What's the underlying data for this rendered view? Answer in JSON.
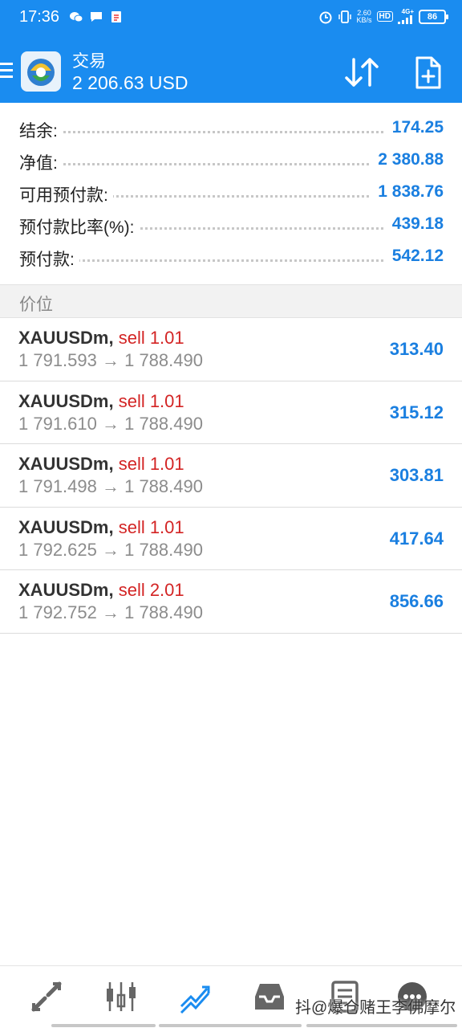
{
  "status_bar": {
    "time": "17:36",
    "net_speed_value": "2.60",
    "net_speed_unit": "KB/s",
    "hd_label": "HD",
    "network_label": "4G+",
    "battery": "86"
  },
  "app_bar": {
    "title": "交易",
    "balance": "2 206.63 USD"
  },
  "summary": [
    {
      "label": "结余:",
      "value": "174.25"
    },
    {
      "label": "净值:",
      "value": "2 380.88"
    },
    {
      "label": "可用预付款:",
      "value": "1 838.76"
    },
    {
      "label": "预付款比率(%):",
      "value": "439.18"
    },
    {
      "label": "预付款:",
      "value": "542.12"
    }
  ],
  "section_header": "价位",
  "positions": [
    {
      "symbol": "XAUUSDm,",
      "side": "sell 1.01",
      "prices": "1 791.593 → 1 788.490",
      "profit": "313.40"
    },
    {
      "symbol": "XAUUSDm,",
      "side": "sell 1.01",
      "prices": "1 791.610 → 1 788.490",
      "profit": "315.12"
    },
    {
      "symbol": "XAUUSDm,",
      "side": "sell 1.01",
      "prices": "1 791.498 → 1 788.490",
      "profit": "303.81"
    },
    {
      "symbol": "XAUUSDm,",
      "side": "sell 1.01",
      "prices": "1 792.625 → 1 788.490",
      "profit": "417.64"
    },
    {
      "symbol": "XAUUSDm,",
      "side": "sell 2.01",
      "prices": "1 792.752 → 1 788.490",
      "profit": "856.66"
    }
  ],
  "bottom_nav": {
    "items": [
      "quotes-icon",
      "chart-icon",
      "trade-icon",
      "history-icon",
      "messages-icon",
      "settings-icon"
    ],
    "active": "trade-icon"
  },
  "watermark": "抖@爆仓赌王李佛摩尔",
  "colors": {
    "primary": "#1a8cf0",
    "value_blue": "#1a7fe0",
    "sell_red": "#d32424"
  }
}
